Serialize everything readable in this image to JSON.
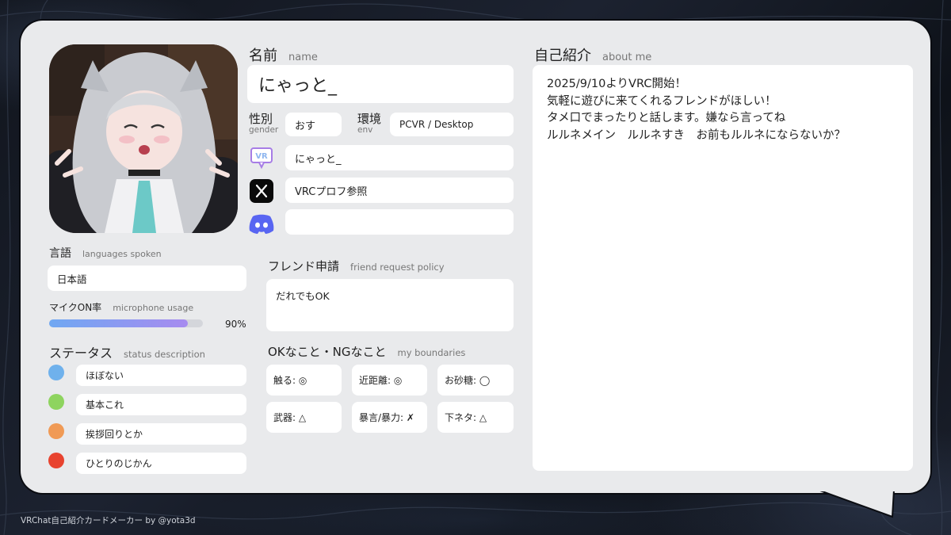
{
  "colors": {
    "card_bg": "#e9eaec",
    "field_bg": "#ffffff",
    "progress_start": "#6fa8f2",
    "progress_end": "#a78bf0",
    "status_blue": "#6fb1ec",
    "status_green": "#8ed45f",
    "status_orange": "#f09a55",
    "status_red": "#e8432f",
    "discord": "#5865f2",
    "vrc_purple": "#a77de6"
  },
  "profile": {
    "name_label": "名前",
    "name_sub": "name",
    "name": "にゃっと_",
    "gender_label": "性別",
    "gender_sub": "gender",
    "gender": "おす",
    "env_label": "環境",
    "env_sub": "env",
    "env": "PCVR / Desktop",
    "vrc_icon": "vrchat-icon",
    "vrc_name": "にゃっと_",
    "x_icon": "x-logo-icon",
    "x_account": "VRCプロフ参照",
    "discord_icon": "discord-icon",
    "discord_account": ""
  },
  "languages": {
    "label": "言語",
    "sub": "languages spoken",
    "value": "日本語"
  },
  "mic": {
    "label": "マイクON率",
    "sub": "microphone usage",
    "percent_text": "90%",
    "fraction": 0.9
  },
  "status": {
    "label": "ステータス",
    "sub": "status description",
    "items": [
      {
        "color": "#6fb1ec",
        "text": "ほぼない"
      },
      {
        "color": "#8ed45f",
        "text": "基本これ"
      },
      {
        "color": "#f09a55",
        "text": "挨拶回りとか"
      },
      {
        "color": "#e8432f",
        "text": "ひとりのじかん"
      }
    ]
  },
  "friend_request": {
    "label": "フレンド申請",
    "sub": "friend request policy",
    "value": "だれでもOK"
  },
  "boundaries": {
    "label": "OKなこと・NGなこと",
    "sub": "my boundaries",
    "items": [
      "触る: ◎",
      "近距離: ◎",
      "お砂糖: ◯",
      "武器: △",
      "暴言/暴力: ✗",
      "下ネタ: △"
    ]
  },
  "about": {
    "label": "自己紹介",
    "sub": "about me",
    "text": "2025/9/10よりVRC開始！\n気軽に遊びに来てくれるフレンドがほしい！\nタメ口でまったりと話します。嫌なら言ってね\nルルネメイン　ルルネすき　お前もルルネにならないか？"
  },
  "footer": "VRChat自己紹介カードメーカー by @yota3d"
}
